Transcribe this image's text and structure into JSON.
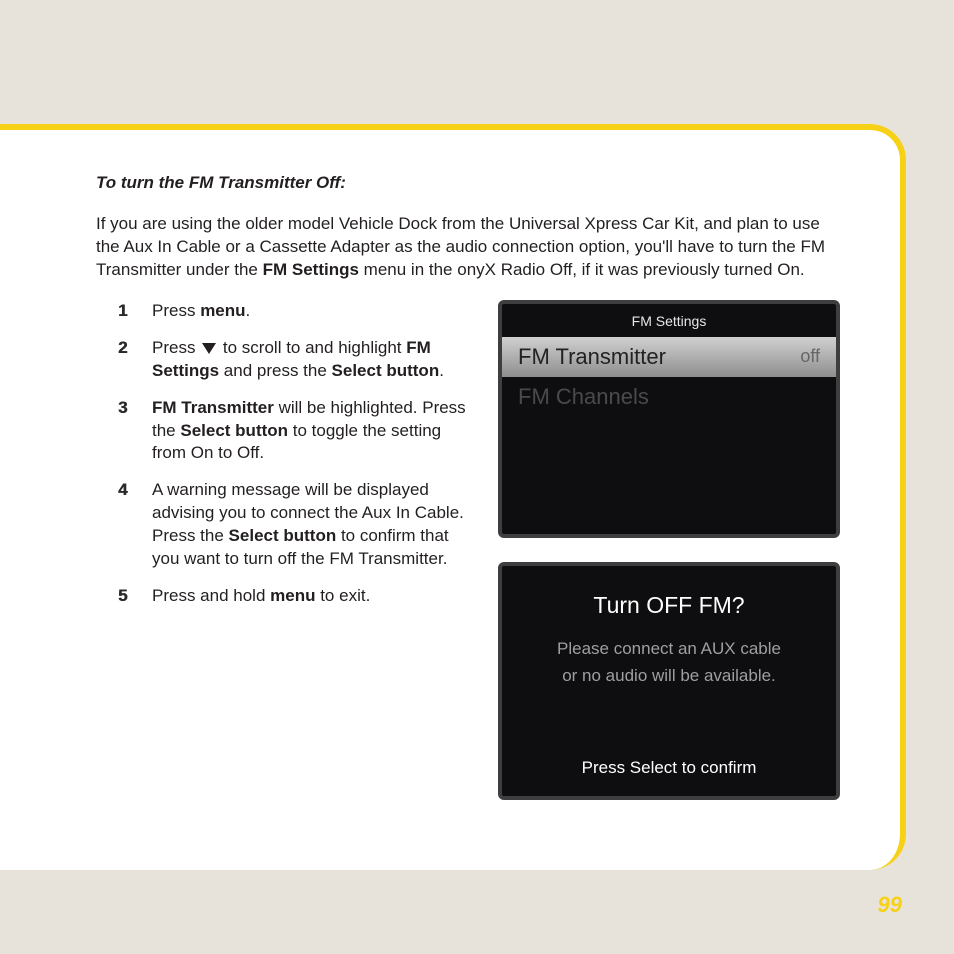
{
  "heading": "To turn the FM Transmitter Off:",
  "intro": {
    "p1a": "If you are using the older model Vehicle Dock from the Universal Xpress Car Kit, and plan to use the Aux In Cable or a Cassette Adapter as the audio connection option, you'll have to turn the FM Transmitter under the ",
    "p1b": "FM Settings",
    "p1c": " menu in the onyX Radio Off, if it was previously turned On."
  },
  "steps": {
    "s1": {
      "num": "1",
      "a": "Press ",
      "b": "menu",
      "c": "."
    },
    "s2": {
      "num": "2",
      "a": "Press ",
      "b": " to scroll to and highlight ",
      "c": "FM Settings",
      "d": " and press the ",
      "e": "Select button",
      "f": "."
    },
    "s3": {
      "num": "3",
      "a": "FM Transmitter",
      "b": " will be highlighted. Press the ",
      "c": "Select button",
      "d": " to toggle the setting from On to Off."
    },
    "s4": {
      "num": "4",
      "a": "A warning message will be displayed advising you to connect the Aux In Cable. Press the ",
      "b": "Select button",
      "c": " to confirm that you want to turn off the FM Transmitter."
    },
    "s5": {
      "num": "5",
      "a": "Press and hold ",
      "b": "menu",
      "c": " to exit."
    }
  },
  "device": {
    "title": "FM Settings",
    "row1_label": "FM Transmitter",
    "row1_value": "off",
    "row2_label": "FM Channels"
  },
  "dialog": {
    "title": "Turn OFF FM?",
    "msg_line1": "Please connect an AUX cable",
    "msg_line2": "or no audio will be available.",
    "action": "Press Select to confirm"
  },
  "page_number": "99"
}
